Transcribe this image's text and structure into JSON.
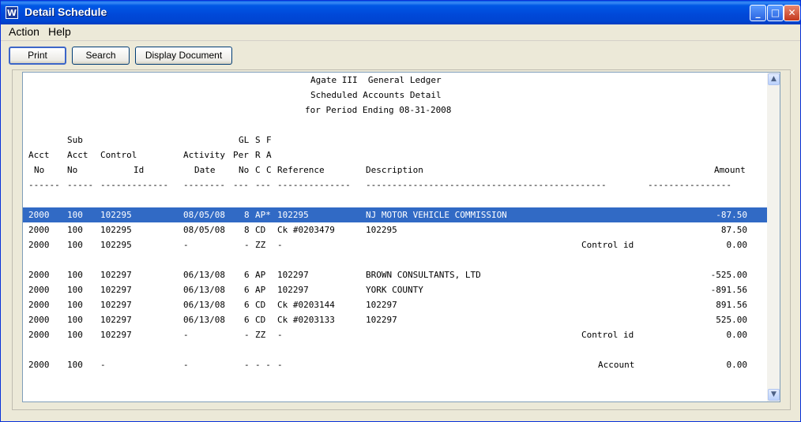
{
  "window": {
    "title": "Detail Schedule",
    "app_icon": "W"
  },
  "titlebar_buttons": {
    "minimize": "_",
    "maximize": "□",
    "close": "✕"
  },
  "menu": {
    "action": "Action",
    "help": "Help"
  },
  "toolbar": {
    "print": "Print",
    "search": "Search",
    "display_document": "Display Document"
  },
  "report": {
    "header1": "Agate III  General Ledger",
    "header2": "Scheduled Accounts Detail",
    "header3": "for Period Ending 08-31-2008",
    "col_head_row1": {
      "sub": "Sub",
      "gl": "GL",
      "s": "S",
      "f": "F"
    },
    "col_head_row2": {
      "acct": "Acct",
      "sub_acct": "Acct",
      "control": "Control",
      "activity": "Activity",
      "per": "Per",
      "r": "R",
      "a": "A"
    },
    "col_head_row3": {
      "no": "No",
      "sub_no": "No",
      "id": "Id",
      "date": "Date",
      "gl_no": "No",
      "c1": "C",
      "c2": "C",
      "reference": "Reference",
      "description": "Description",
      "amount": "Amount"
    },
    "separator": {
      "acct": "------",
      "sub": "-----",
      "control": "-------------",
      "date": "--------",
      "per": "---",
      "src": "---",
      "reference": "--------------",
      "description": "----------------------------------------------",
      "amount": "----------------"
    },
    "rows": [
      {
        "acct": "2000",
        "sub": "100",
        "control": "102295",
        "date": "08/05/08",
        "per": "8",
        "src": "AP*",
        "reference": "102295",
        "description": "NJ MOTOR VEHICLE COMMISSION",
        "note": "",
        "amount": "-87.50"
      },
      {
        "acct": "2000",
        "sub": "100",
        "control": "102295",
        "date": "08/05/08",
        "per": "8",
        "src": "CD",
        "reference": "Ck #0203479",
        "description": "102295",
        "note": "",
        "amount": "87.50"
      },
      {
        "acct": "2000",
        "sub": "100",
        "control": "102295",
        "date": "-",
        "per": "-",
        "src": "ZZ",
        "reference": "-",
        "description": "",
        "note": "Control id",
        "amount": "0.00"
      },
      {
        "acct": "2000",
        "sub": "100",
        "control": "102297",
        "date": "06/13/08",
        "per": "6",
        "src": "AP",
        "reference": "102297",
        "description": "BROWN CONSULTANTS, LTD",
        "note": "",
        "amount": "-525.00"
      },
      {
        "acct": "2000",
        "sub": "100",
        "control": "102297",
        "date": "06/13/08",
        "per": "6",
        "src": "AP",
        "reference": "102297",
        "description": "YORK COUNTY",
        "note": "",
        "amount": "-891.56"
      },
      {
        "acct": "2000",
        "sub": "100",
        "control": "102297",
        "date": "06/13/08",
        "per": "6",
        "src": "CD",
        "reference": "Ck #0203144",
        "description": "102297",
        "note": "",
        "amount": "891.56"
      },
      {
        "acct": "2000",
        "sub": "100",
        "control": "102297",
        "date": "06/13/08",
        "per": "6",
        "src": "CD",
        "reference": "Ck #0203133",
        "description": "102297",
        "note": "",
        "amount": "525.00"
      },
      {
        "acct": "2000",
        "sub": "100",
        "control": "102297",
        "date": "-",
        "per": "-",
        "src": "ZZ",
        "reference": "-",
        "description": "",
        "note": "Control id",
        "amount": "0.00"
      },
      {
        "acct": "2000",
        "sub": "100",
        "control": "-",
        "date": "-",
        "per": "-",
        "src": "- -",
        "reference": "-",
        "description": "",
        "note": "Account",
        "amount": "0.00"
      }
    ]
  }
}
